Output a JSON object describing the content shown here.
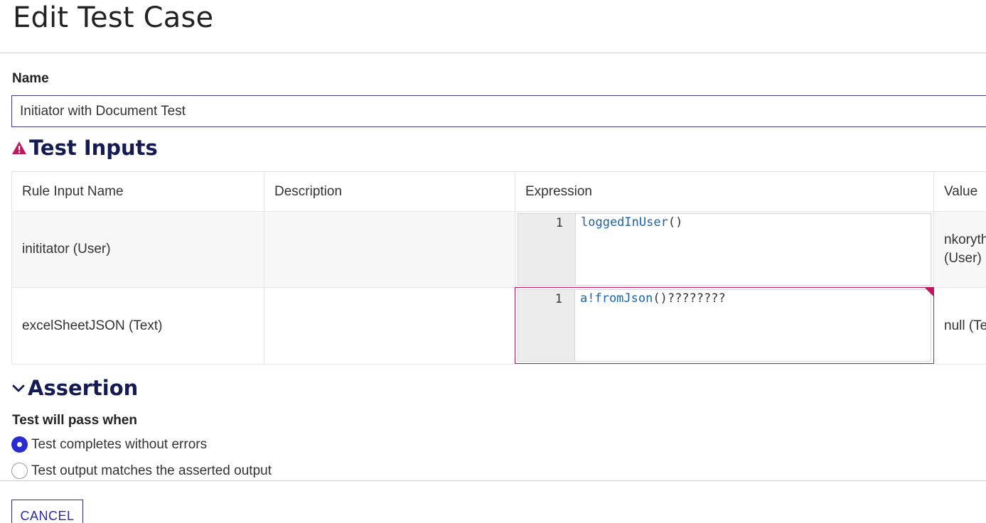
{
  "page": {
    "title": "Edit Test Case"
  },
  "name_field": {
    "label": "Name",
    "value": "Initiator with Document Test"
  },
  "test_inputs": {
    "heading": "Test Inputs",
    "icon": "warning-icon",
    "columns": [
      "Rule Input Name",
      "Description",
      "Expression",
      "Value"
    ],
    "rows": [
      {
        "rule_input_name": "inititator (User)",
        "description": "",
        "line_number": "1",
        "expression_fn": "loggedInUser",
        "expression_rest": "()",
        "value_line1": "nkoryth",
        "value_line2": "(User)"
      },
      {
        "rule_input_name": "excelSheetJSON (Text)",
        "description": "",
        "line_number": "1",
        "expression_fn": "a!fromJson",
        "expression_rest": "()????????",
        "value_line1": "null (Te",
        "has_error": true
      }
    ]
  },
  "assertion": {
    "heading": "Assertion",
    "icon": "chevron-down-icon",
    "pass_label": "Test will pass when",
    "options": [
      {
        "label": "Test completes without errors",
        "selected": true
      },
      {
        "label": "Test output matches the asserted output",
        "selected": false
      }
    ]
  },
  "footer": {
    "cancel_label": "CANCEL"
  },
  "colors": {
    "accent": "#2b2bd6",
    "heading": "#141a52",
    "error": "#c0175d"
  }
}
